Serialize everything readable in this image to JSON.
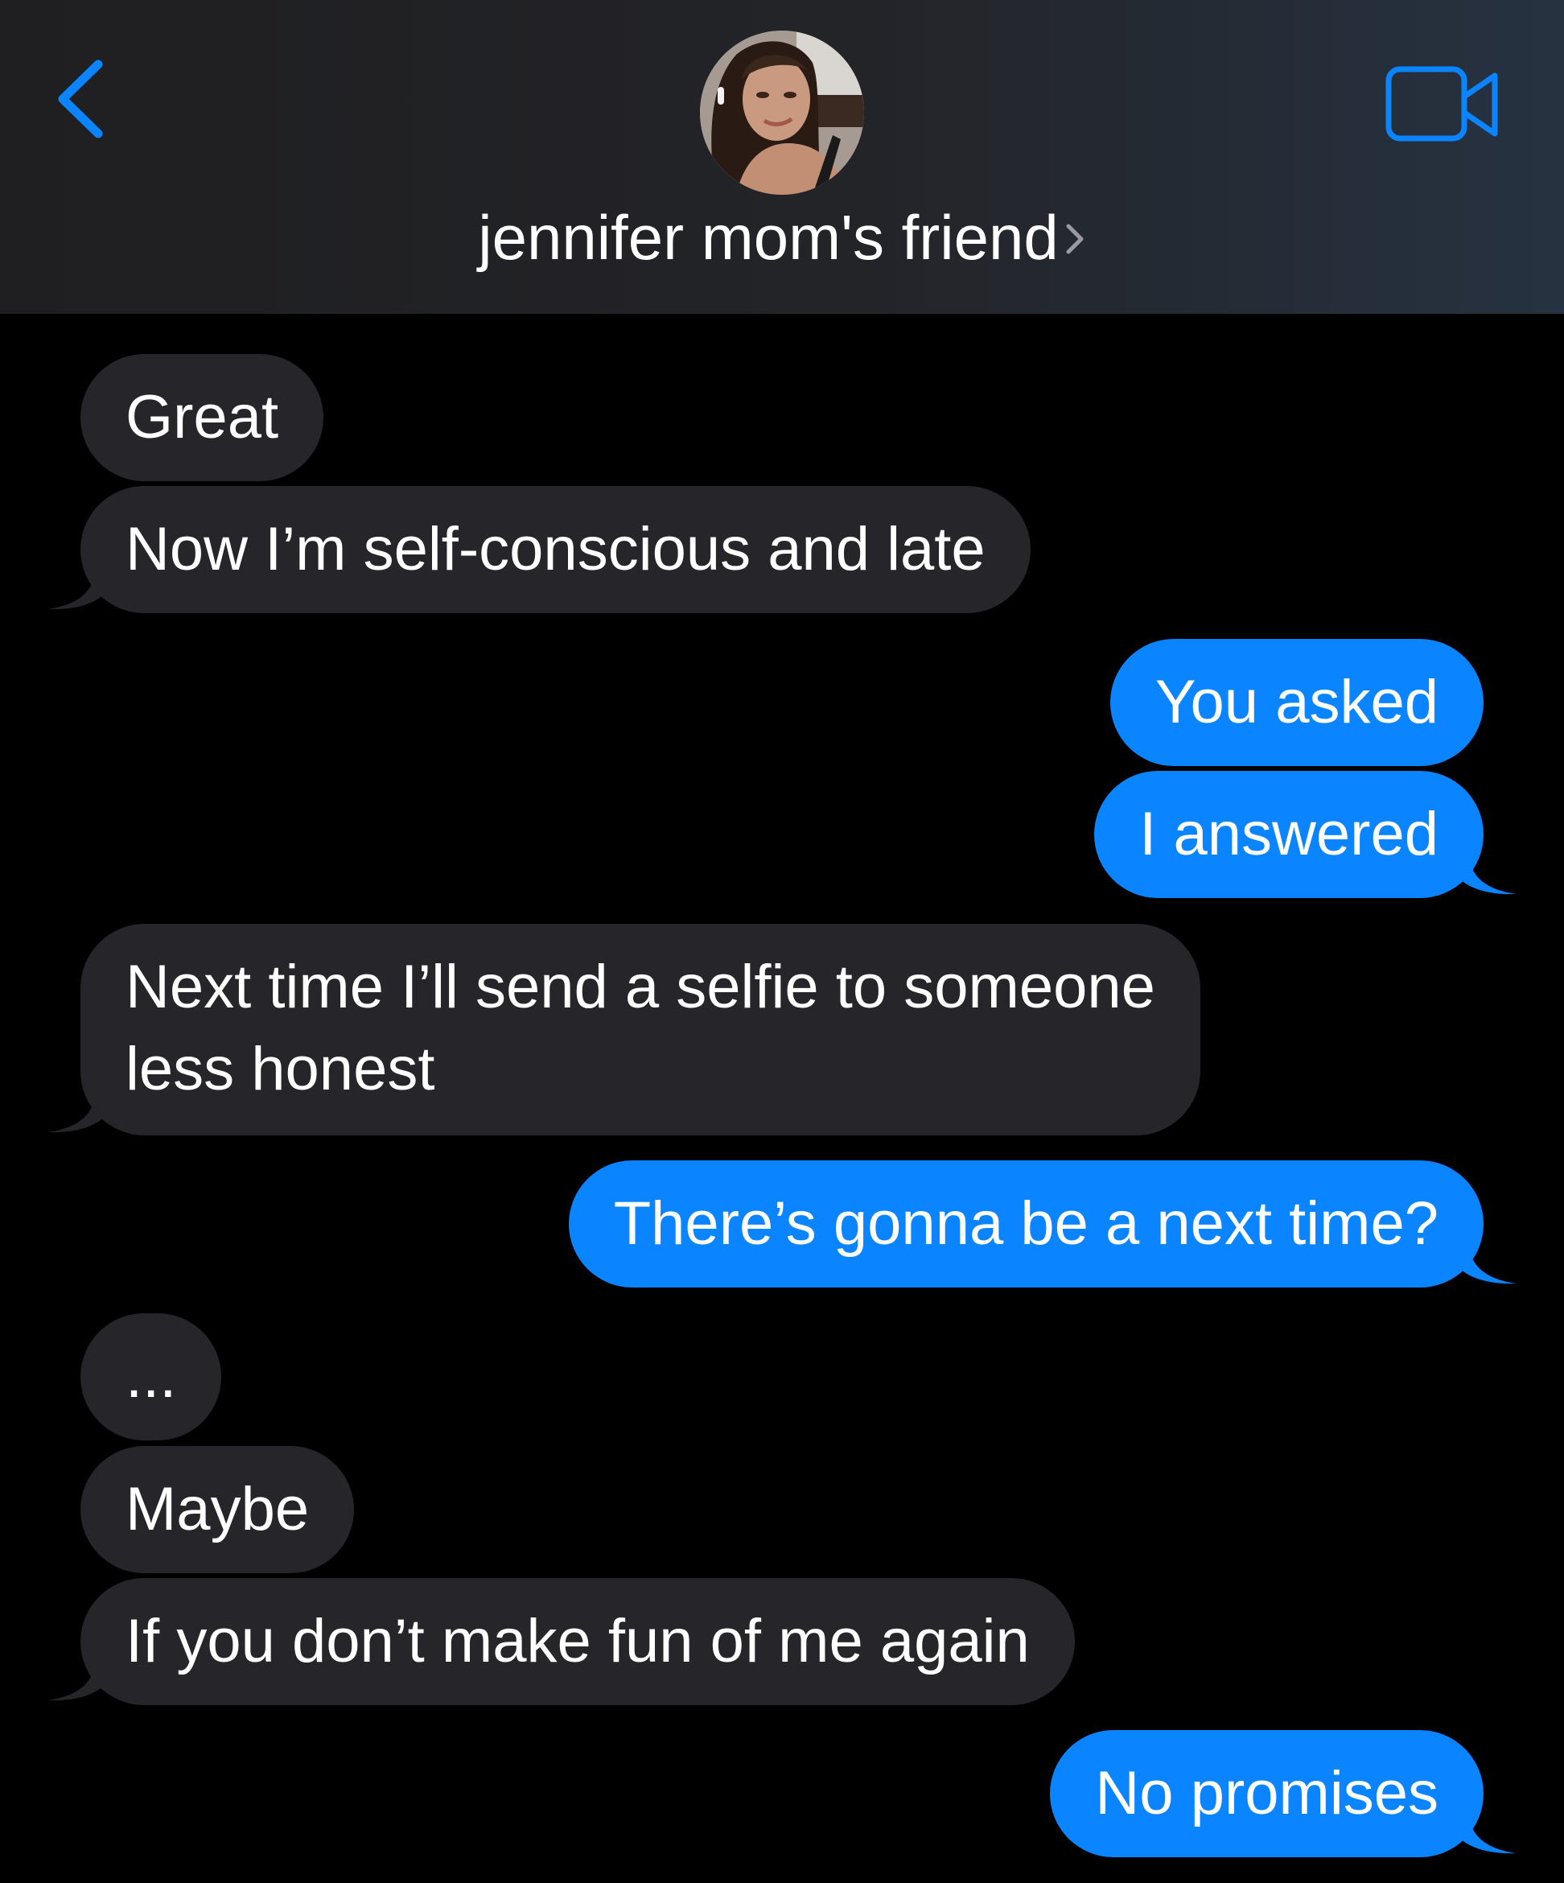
{
  "header": {
    "contact_name": "jennifer mom's friend",
    "back_icon": "chevron-left-icon",
    "video_icon": "video-camera-icon",
    "accent_color": "#0a84ff"
  },
  "messages": [
    {
      "sender": "them",
      "text": "Great"
    },
    {
      "sender": "them",
      "text": "Now I’m self-conscious and late"
    },
    {
      "sender": "me",
      "text": "You asked"
    },
    {
      "sender": "me",
      "text": "I answered"
    },
    {
      "sender": "them",
      "text_line1": "Next time I’ll send a selfie to someone",
      "text_line2": "less honest"
    },
    {
      "sender": "me",
      "text": "There’s gonna be a next time?"
    },
    {
      "sender": "them",
      "text": "..."
    },
    {
      "sender": "them",
      "text": "Maybe"
    },
    {
      "sender": "them",
      "text": "If you don’t make fun of me again"
    },
    {
      "sender": "me",
      "text": "No promises"
    }
  ],
  "colors": {
    "incoming_bubble": "#26252a",
    "outgoing_bubble": "#0a84ff",
    "background": "#000000"
  }
}
